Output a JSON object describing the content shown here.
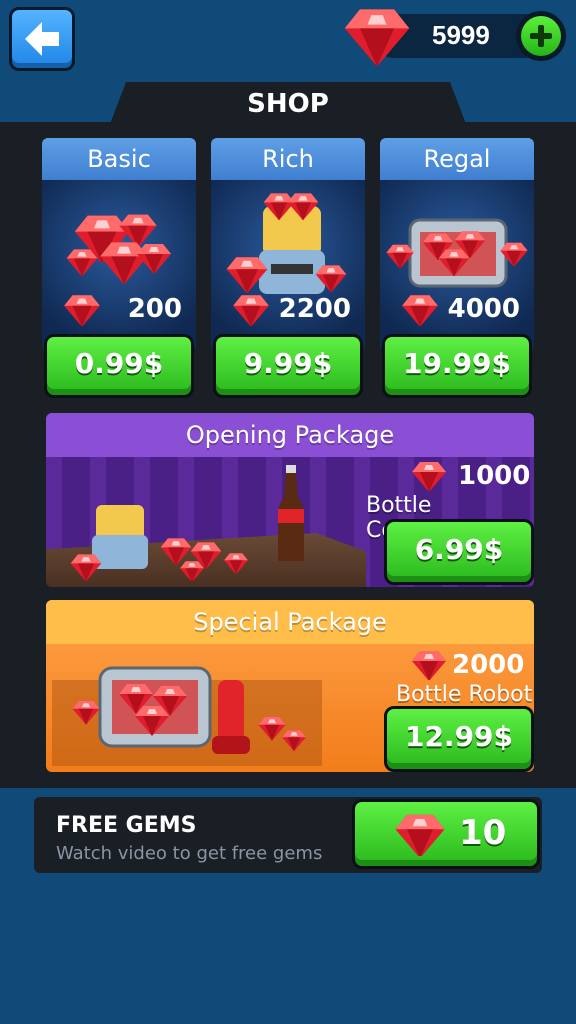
{
  "header": {
    "gem_balance": "5999",
    "colors": {
      "accent_blue": "#3a8ee6",
      "buy_green": "#39d22a",
      "gem_red": "#e01d2c"
    },
    "icons": {
      "back": "arrow-left-icon",
      "currency": "ruby-gem-icon",
      "add": "plus-icon"
    }
  },
  "shop": {
    "title": "SHOP"
  },
  "tiers": [
    {
      "name": "Basic",
      "gems": "200",
      "price": "0.99$"
    },
    {
      "name": "Rich",
      "gems": "2200",
      "price": "9.99$"
    },
    {
      "name": "Regal",
      "gems": "4000",
      "price": "19.99$"
    }
  ],
  "packages": [
    {
      "title": "Opening Package",
      "gems": "1000",
      "bonus": "Bottle Cocacola",
      "price": "6.99$",
      "color": "#8a4fd4"
    },
    {
      "title": "Special Package",
      "gems": "2000",
      "bonus": "Bottle Robot",
      "price": "12.99$",
      "color": "#ffbd4a"
    }
  ],
  "free_gems": {
    "title": "FREE GEMS",
    "subtitle": "Watch video to get free gems",
    "reward": "10"
  }
}
